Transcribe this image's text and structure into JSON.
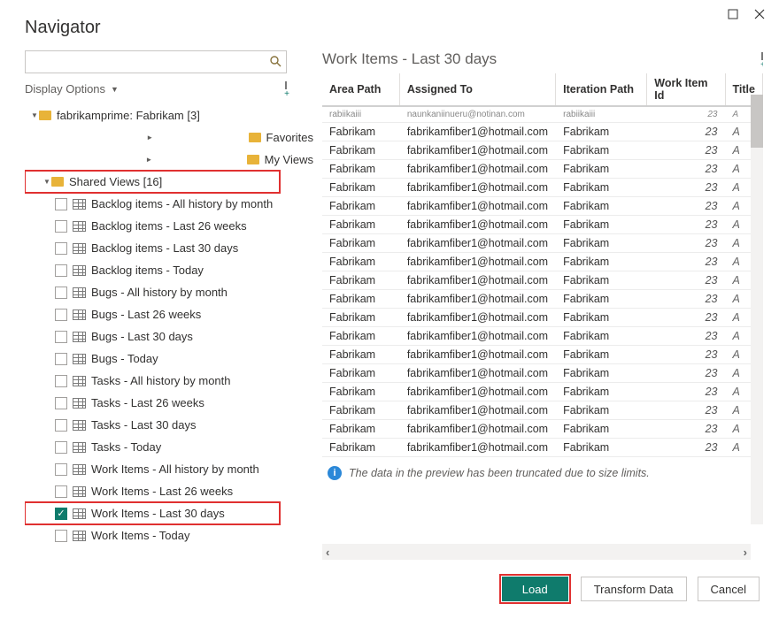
{
  "window": {
    "title": "Navigator"
  },
  "left": {
    "display_options_label": "Display Options",
    "root": {
      "label": "fabrikamprime: Fabrikam [3]"
    },
    "folders": [
      {
        "label": "Favorites"
      },
      {
        "label": "My Views"
      }
    ],
    "shared": {
      "label": "Shared Views [16]"
    },
    "shared_items": [
      {
        "label": "Backlog items - All history by month",
        "checked": false
      },
      {
        "label": "Backlog items - Last 26 weeks",
        "checked": false
      },
      {
        "label": "Backlog items - Last 30 days",
        "checked": false
      },
      {
        "label": "Backlog items - Today",
        "checked": false
      },
      {
        "label": "Bugs - All history by month",
        "checked": false
      },
      {
        "label": "Bugs - Last 26 weeks",
        "checked": false
      },
      {
        "label": "Bugs - Last 30 days",
        "checked": false
      },
      {
        "label": "Bugs - Today",
        "checked": false
      },
      {
        "label": "Tasks - All history by month",
        "checked": false
      },
      {
        "label": "Tasks - Last 26 weeks",
        "checked": false
      },
      {
        "label": "Tasks - Last 30 days",
        "checked": false
      },
      {
        "label": "Tasks - Today",
        "checked": false
      },
      {
        "label": "Work Items - All history by month",
        "checked": false
      },
      {
        "label": "Work Items - Last 26 weeks",
        "checked": false
      },
      {
        "label": "Work Items - Last 30 days",
        "checked": true
      },
      {
        "label": "Work Items - Today",
        "checked": false
      }
    ]
  },
  "preview": {
    "title": "Work Items - Last 30 days",
    "columns": [
      "Area Path",
      "Assigned To",
      "Iteration Path",
      "Work Item Id",
      "Title"
    ],
    "truncated_row": {
      "area": "rabiikaiii",
      "assigned": "naunkaniinueru@notinan.com",
      "iter": "rabiikaiii",
      "id": "23",
      "t": "A"
    },
    "rows": [
      {
        "area": "Fabrikam",
        "assigned": "fabrikamfiber1@hotmail.com",
        "iter": "Fabrikam",
        "id": "23",
        "t": "A"
      },
      {
        "area": "Fabrikam",
        "assigned": "fabrikamfiber1@hotmail.com",
        "iter": "Fabrikam",
        "id": "23",
        "t": "A"
      },
      {
        "area": "Fabrikam",
        "assigned": "fabrikamfiber1@hotmail.com",
        "iter": "Fabrikam",
        "id": "23",
        "t": "A"
      },
      {
        "area": "Fabrikam",
        "assigned": "fabrikamfiber1@hotmail.com",
        "iter": "Fabrikam",
        "id": "23",
        "t": "A"
      },
      {
        "area": "Fabrikam",
        "assigned": "fabrikamfiber1@hotmail.com",
        "iter": "Fabrikam",
        "id": "23",
        "t": "A"
      },
      {
        "area": "Fabrikam",
        "assigned": "fabrikamfiber1@hotmail.com",
        "iter": "Fabrikam",
        "id": "23",
        "t": "A"
      },
      {
        "area": "Fabrikam",
        "assigned": "fabrikamfiber1@hotmail.com",
        "iter": "Fabrikam",
        "id": "23",
        "t": "A"
      },
      {
        "area": "Fabrikam",
        "assigned": "fabrikamfiber1@hotmail.com",
        "iter": "Fabrikam",
        "id": "23",
        "t": "A"
      },
      {
        "area": "Fabrikam",
        "assigned": "fabrikamfiber1@hotmail.com",
        "iter": "Fabrikam",
        "id": "23",
        "t": "A"
      },
      {
        "area": "Fabrikam",
        "assigned": "fabrikamfiber1@hotmail.com",
        "iter": "Fabrikam",
        "id": "23",
        "t": "A"
      },
      {
        "area": "Fabrikam",
        "assigned": "fabrikamfiber1@hotmail.com",
        "iter": "Fabrikam",
        "id": "23",
        "t": "A"
      },
      {
        "area": "Fabrikam",
        "assigned": "fabrikamfiber1@hotmail.com",
        "iter": "Fabrikam",
        "id": "23",
        "t": "A"
      },
      {
        "area": "Fabrikam",
        "assigned": "fabrikamfiber1@hotmail.com",
        "iter": "Fabrikam",
        "id": "23",
        "t": "A"
      },
      {
        "area": "Fabrikam",
        "assigned": "fabrikamfiber1@hotmail.com",
        "iter": "Fabrikam",
        "id": "23",
        "t": "A"
      },
      {
        "area": "Fabrikam",
        "assigned": "fabrikamfiber1@hotmail.com",
        "iter": "Fabrikam",
        "id": "23",
        "t": "A"
      },
      {
        "area": "Fabrikam",
        "assigned": "fabrikamfiber1@hotmail.com",
        "iter": "Fabrikam",
        "id": "23",
        "t": "A"
      },
      {
        "area": "Fabrikam",
        "assigned": "fabrikamfiber1@hotmail.com",
        "iter": "Fabrikam",
        "id": "23",
        "t": "A"
      },
      {
        "area": "Fabrikam",
        "assigned": "fabrikamfiber1@hotmail.com",
        "iter": "Fabrikam",
        "id": "23",
        "t": "A"
      }
    ],
    "info_text": "The data in the preview has been truncated due to size limits."
  },
  "footer": {
    "load": "Load",
    "transform": "Transform Data",
    "cancel": "Cancel"
  }
}
